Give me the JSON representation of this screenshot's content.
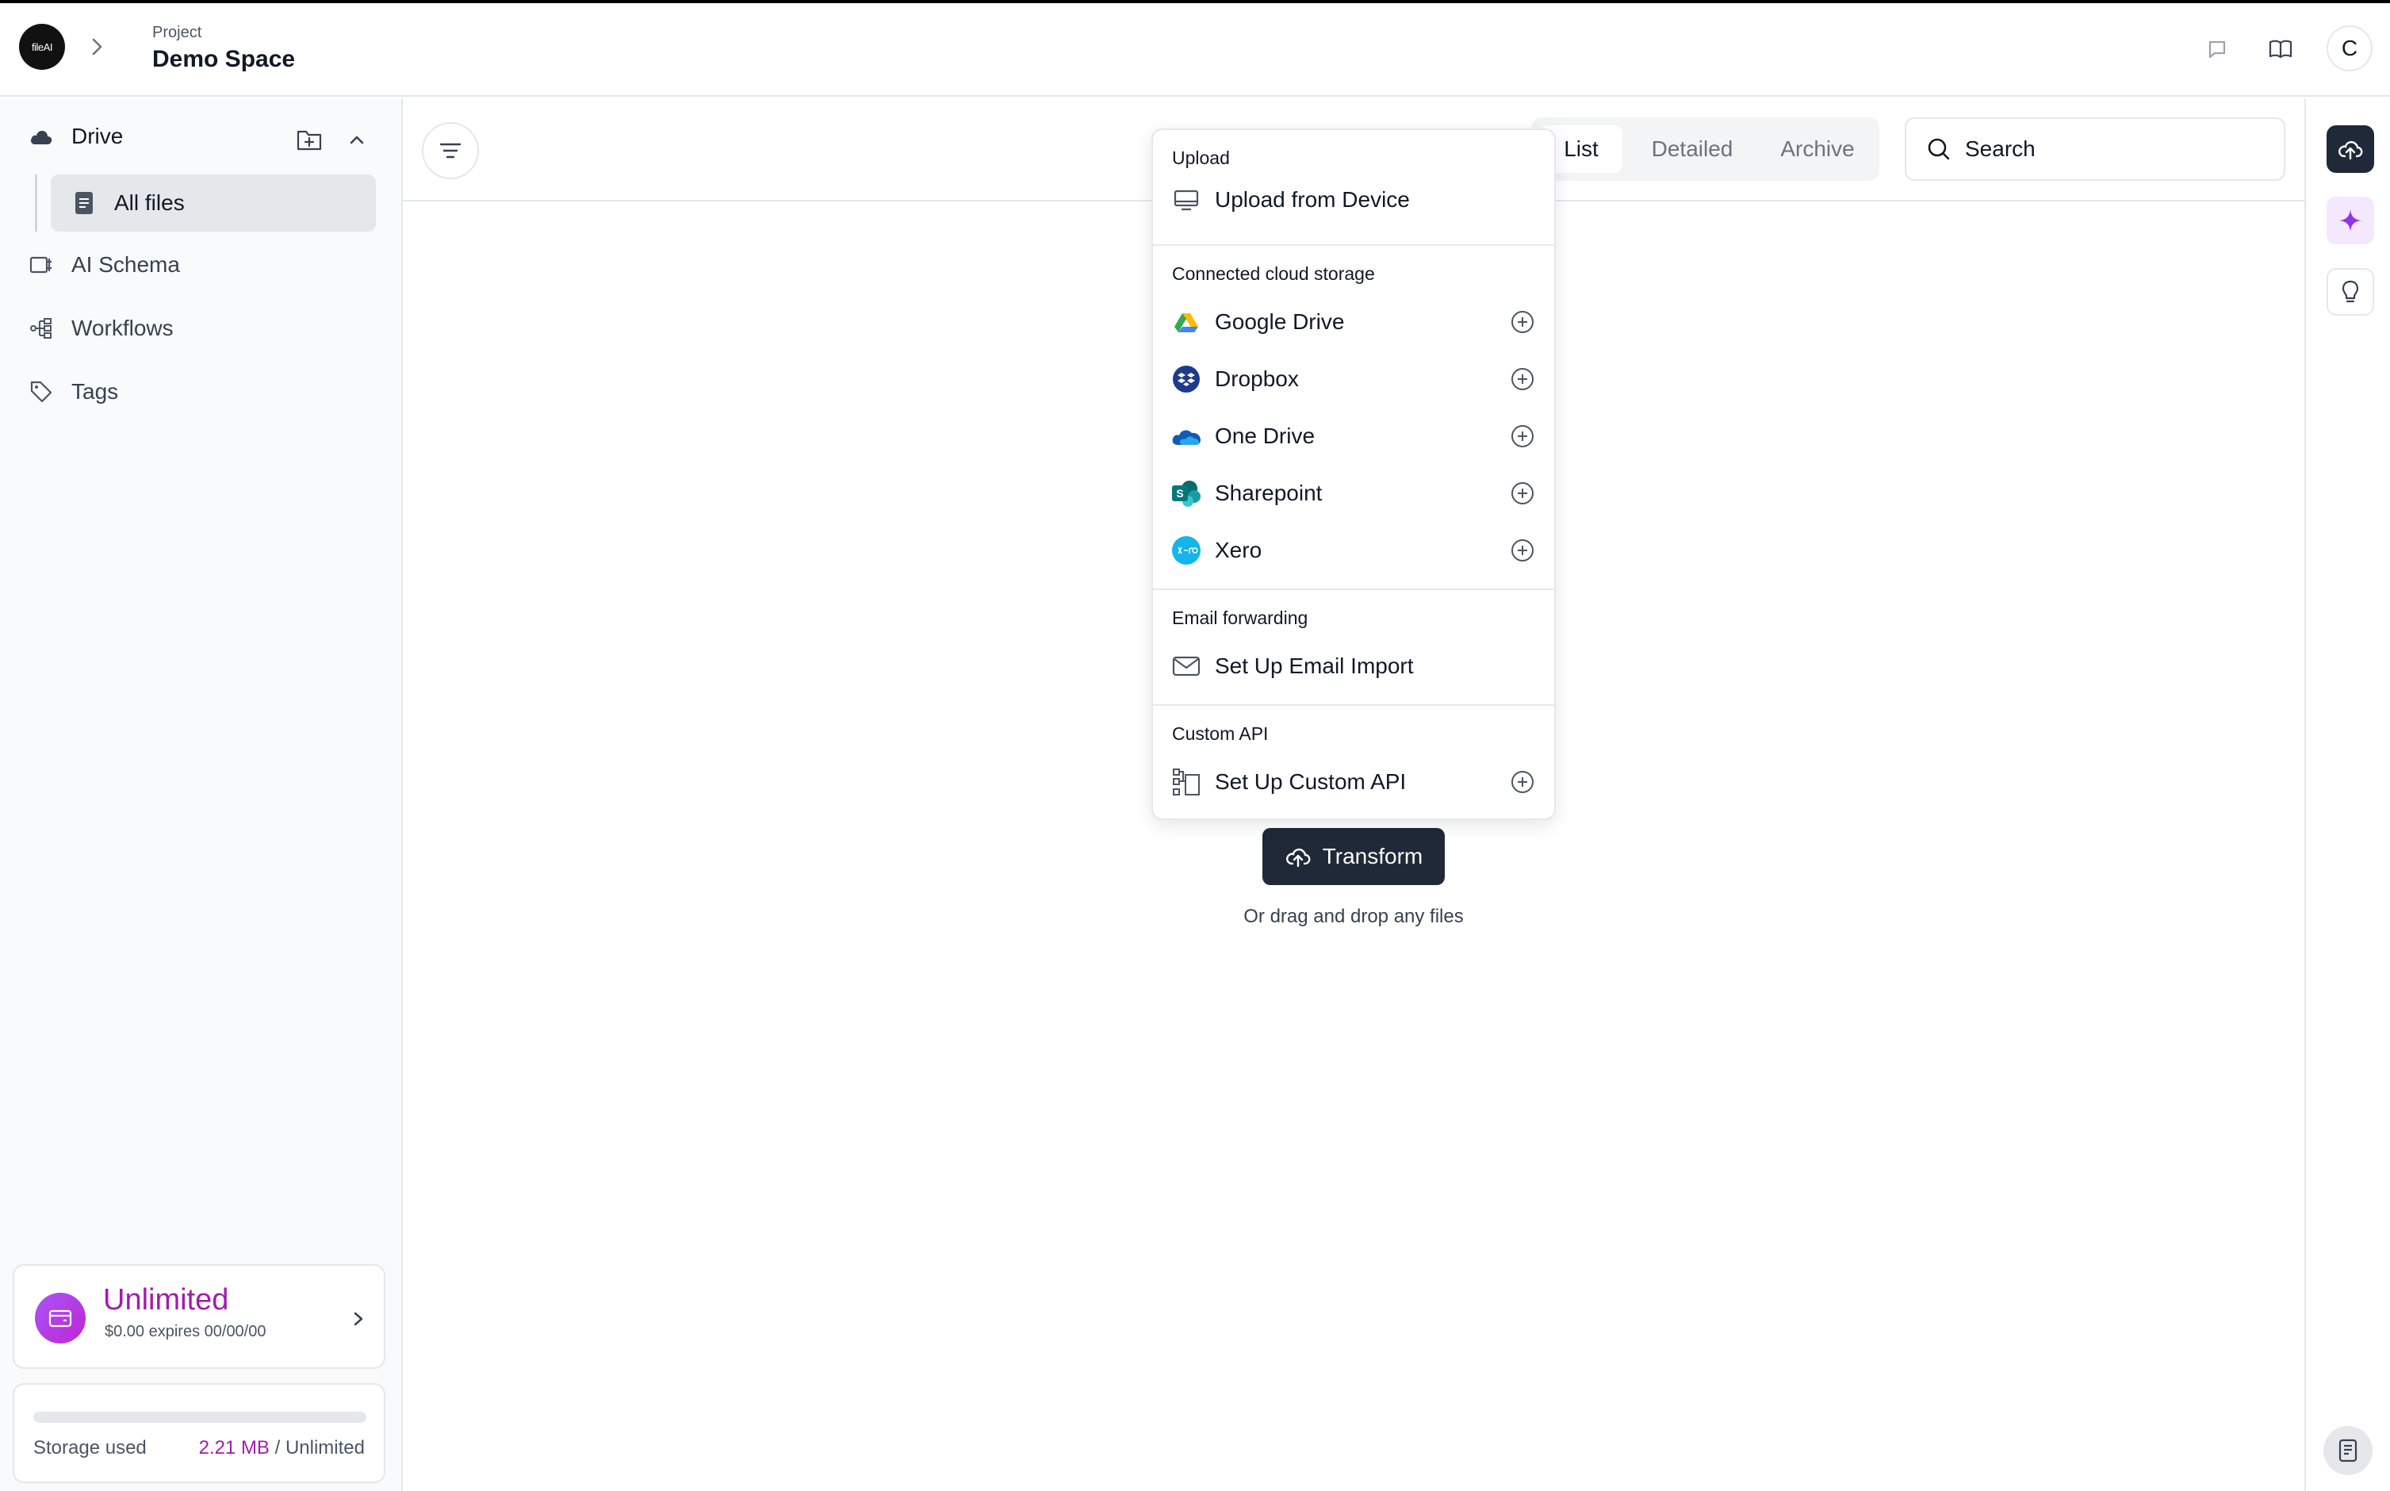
{
  "header": {
    "logo_text": "fileAI",
    "project_label": "Project",
    "project_name": "Demo Space",
    "avatar_letter": "C"
  },
  "sidebar": {
    "drive_label": "Drive",
    "all_files_label": "All files",
    "items": [
      {
        "label": "AI Schema",
        "icon": "schema-icon"
      },
      {
        "label": "Workflows",
        "icon": "workflow-icon"
      },
      {
        "label": "Tags",
        "icon": "tag-icon"
      }
    ],
    "plan": {
      "name": "Unlimited",
      "expires": "$0.00 expires 00/00/00"
    },
    "storage": {
      "label": "Storage used",
      "used": "2.21 MB",
      "limit": "/ Unlimited",
      "fill_fraction": 0.0
    }
  },
  "toolbar": {
    "tabs": [
      "List",
      "Detailed",
      "Archive"
    ],
    "active_tab": "List",
    "search_label": "Search"
  },
  "dropdown": {
    "sections": [
      {
        "title": "Upload",
        "items": [
          {
            "label": "Upload from Device",
            "icon": "monitor-icon",
            "addable": false
          }
        ]
      },
      {
        "title": "Connected cloud storage",
        "items": [
          {
            "label": "Google Drive",
            "icon": "google-drive-icon",
            "addable": true
          },
          {
            "label": "Dropbox",
            "icon": "dropbox-icon",
            "addable": true
          },
          {
            "label": "One Drive",
            "icon": "onedrive-icon",
            "addable": true
          },
          {
            "label": "Sharepoint",
            "icon": "sharepoint-icon",
            "addable": true
          },
          {
            "label": "Xero",
            "icon": "xero-icon",
            "addable": true
          }
        ]
      },
      {
        "title": "Email forwarding",
        "items": [
          {
            "label": "Set Up Email Import",
            "icon": "mail-icon",
            "addable": false
          }
        ]
      },
      {
        "title": "Custom API",
        "items": [
          {
            "label": "Set Up Custom API",
            "icon": "api-icon",
            "addable": true
          }
        ]
      }
    ]
  },
  "main": {
    "transform_label": "Transform",
    "drag_hint": "Or drag and drop any files"
  },
  "colors": {
    "accent": "#a21caf",
    "dark_button": "#1f2937",
    "border": "#e5e7eb"
  }
}
